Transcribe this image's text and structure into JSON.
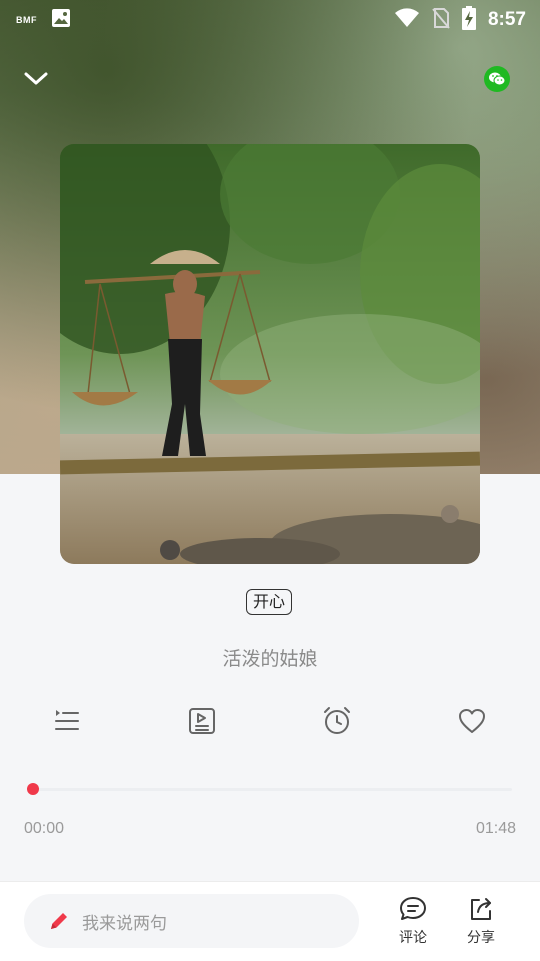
{
  "status_bar": {
    "carrier_logo": "BMF",
    "time": "8:57",
    "icons": [
      "gallery-icon",
      "wifi-icon",
      "no-sim-icon",
      "battery-charging-icon"
    ]
  },
  "top_bar": {
    "back_icon": "chevron-down-icon",
    "share_icon": "wechat-icon",
    "wechat_color": "#1fb922"
  },
  "cover": {
    "description_icon": "album-cover-image"
  },
  "mood_tag": "开心",
  "song_title": "活泼的姑娘",
  "actions": [
    {
      "name": "playlist-icon"
    },
    {
      "name": "lyrics-icon"
    },
    {
      "name": "alarm-clock-icon"
    },
    {
      "name": "heart-icon"
    }
  ],
  "player": {
    "progress": 0,
    "current_time": "00:00",
    "total_time": "01:48",
    "accent_color": "#f0394a"
  },
  "bottom_bar": {
    "comment_placeholder": "我来说两句",
    "comment_label": "评论",
    "share_label": "分享"
  }
}
